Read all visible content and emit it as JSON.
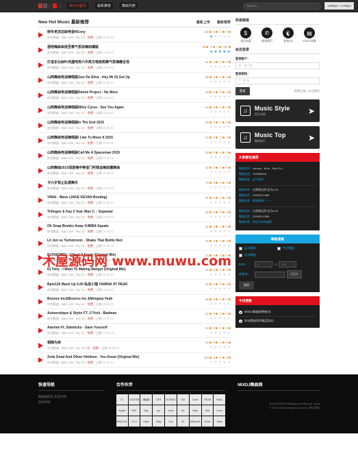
{
  "browser": {
    "nav_items": [
      {
        "label": "MIXDJ首页",
        "accent": true
      },
      {
        "label": "最新推荐",
        "accent": false
      },
      {
        "label": "舞曲列表",
        "accent": false
      }
    ],
    "search_placeholder": "Search...",
    "resolution_badge": "1366px × 1783px"
  },
  "main": {
    "title": "New Hot Music 最新推荐",
    "column_headers": [
      "最新上传",
      "最新推荐"
    ],
    "songs": [
      {
        "title": "晓冬老凉迈曲电音M1ony",
        "meta_type": "综合舞曲",
        "bpm": "Bpm 128",
        "key": "key 12",
        "tag": "免费",
        "date_label": "日期",
        "time": "15.09.02",
        "stats": [
          "128",
          "0",
          "0",
          "0"
        ],
        "stars": 1
      },
      {
        "title": "酒吧嗨曲串烧至尊气氛劲嗨劲爆版",
        "meta_type": "综合舞曲",
        "bpm": "Bpm 128",
        "key": "key 12",
        "tag": "免费",
        "date_label": "日期",
        "time": "15.09.02",
        "stats": [
          "90",
          "0",
          "0",
          "191"
        ],
        "stars": 5
      },
      {
        "title": "打造东北树叶鸿遇吧男六中英文唱夜照舞气氛嗨爆全场",
        "meta_type": "综合舞曲",
        "bpm": "Bpm 128",
        "key": "key 12",
        "tag": "免费",
        "date_label": "日期",
        "time": "15.09.02",
        "stats": [
          "82",
          "0",
          "0",
          "0"
        ],
        "stars": 0
      },
      {
        "title": "山西舞曲电话嗨唱版Geo Da Silva - Hey Mr Dj Get Up",
        "meta_type": "综合舞曲",
        "bpm": "Bpm 128",
        "key": "key 12",
        "tag": "免费",
        "date_label": "日期",
        "time": "15.09.02",
        "stats": [
          "88",
          "0",
          "0",
          "0"
        ],
        "stars": 0
      },
      {
        "title": "山西舞曲电话嗨唱版Rimini Project - No More",
        "meta_type": "综合舞曲",
        "bpm": "Bpm 128",
        "key": "key 12",
        "tag": "免费",
        "date_label": "日期",
        "time": "15.09.02",
        "stats": [
          "68",
          "0",
          "0",
          "0"
        ],
        "stars": 0
      },
      {
        "title": "山西舞曲电话嗨唱版Miley Cyrus - See You Again",
        "meta_type": "综合舞曲",
        "bpm": "Bpm 128",
        "key": "key 12",
        "tag": "免费",
        "date_label": "日期",
        "time": "15.09.02",
        "stats": [
          "84",
          "0",
          "0",
          "0"
        ],
        "stars": 0
      },
      {
        "title": "山西舞曲电话嗨唱版In The End 2015",
        "meta_type": "综合舞曲",
        "bpm": "Bpm 128",
        "key": "key 12",
        "tag": "免费",
        "date_label": "日期",
        "time": "15.09.02",
        "stats": [
          "60",
          "0",
          "0",
          "0"
        ],
        "stars": 0
      },
      {
        "title": "山西舞曲电话嗨唱版I Like To Move It 2015",
        "meta_type": "综合舞曲",
        "bpm": "Bpm 128",
        "key": "key 12",
        "tag": "免费",
        "date_label": "日期",
        "time": "15.09.02",
        "stats": [
          "54",
          "0",
          "0",
          "0"
        ],
        "stars": 0
      },
      {
        "title": "山西舞曲电话嗨唱版Call Me A Spaceman 2015",
        "meta_type": "综合舞曲",
        "bpm": "Bpm 128",
        "key": "key 12",
        "tag": "免费",
        "date_label": "日期",
        "time": "15.09.02",
        "stats": [
          "50",
          "0",
          "0",
          "0"
        ],
        "stars": 0
      },
      {
        "title": "山西舞曲2015深度嗨中等音门听贱运嗨劲爆舞曲",
        "meta_type": "综合舞曲",
        "bpm": "Bpm 128",
        "key": "key 12",
        "tag": "免费",
        "date_label": "日期",
        "time": "15.09.02",
        "stats": [
          "52",
          "0",
          "0",
          "0"
        ],
        "stars": 0
      },
      {
        "title": "卡六岁禁止乱煨舞乐",
        "meta_type": "综合舞曲",
        "bpm": "Bpm 128",
        "key": "key 12",
        "tag": "免费",
        "date_label": "日期",
        "time": "15.09.02",
        "stats": [
          "76",
          "0",
          "0",
          "0"
        ],
        "stars": 0
      },
      {
        "title": "VINAI - Wave (JAKE KEVAN Bootleg)",
        "meta_type": "综合舞曲",
        "bpm": "Bpm 128",
        "key": "key 12",
        "tag": "免费",
        "date_label": "日期",
        "time": "15.09.02",
        "stats": [
          "91",
          "0",
          "0",
          "0"
        ],
        "stars": 0
      },
      {
        "title": "Trillogee & Kay C feat. Max C. - Supastar",
        "meta_type": "综合舞曲",
        "bpm": "Bpm 128",
        "key": "key 12",
        "tag": "免费",
        "date_label": "日期",
        "time": "15.09.02",
        "stats": [
          "60",
          "0",
          "0",
          "0"
        ],
        "stars": 0
      },
      {
        "title": "Oh Snap Bombs Away G4BBA Squats",
        "meta_type": "综合舞曲",
        "bpm": "Bpm 128",
        "key": "key 12",
        "tag": "免费",
        "date_label": "日期",
        "time": "15.09.02",
        "stats": [
          "62",
          "0",
          "0",
          "0"
        ],
        "stars": 0
      },
      {
        "title": "Lil Jon vs Turbotronic - Shake That Bottle Red",
        "meta_type": "综合舞曲",
        "bpm": "Bpm 128",
        "key": "key 12",
        "tag": "免费",
        "date_label": "日期",
        "time": "15.09.02",
        "stats": [
          "63",
          "0",
          "0",
          "0"
        ],
        "stars": 0
      },
      {
        "title": "DJXIAOWEI - I Need A Freak (Original Mix)",
        "meta_type": "综合舞曲",
        "bpm": "Bpm 128",
        "key": "key 12",
        "tag": "免费",
        "date_label": "日期",
        "time": "15.09.02",
        "stats": [
          "72",
          "0",
          "0",
          "0"
        ],
        "stars": 0
      },
      {
        "title": "Dj Tony - I Want To Making Bangst (Original Mix)",
        "meta_type": "综合舞曲",
        "bpm": "Bpm 128",
        "key": "key 12",
        "tag": "免费",
        "date_label": "日期",
        "time": "15.09.02",
        "stats": [
          "57",
          "0",
          "0",
          "0"
        ],
        "stars": 0
      },
      {
        "title": "Bpm126 Mash Up 5.00 私房小猫 FAMNIA ST PEAK",
        "meta_type": "综合舞曲",
        "bpm": "Bpm 128",
        "key": "key 12",
        "tag": "免费",
        "date_label": "日期",
        "time": "15.09.02",
        "stats": [
          "65",
          "0",
          "0",
          "0"
        ],
        "stars": 0
      },
      {
        "title": "Bounce Inc&Bounce Inc &Morganj-Yeah",
        "meta_type": "综合舞曲",
        "bpm": "Bpm 128",
        "key": "key 12",
        "tag": "免费",
        "date_label": "日期",
        "time": "15.09.02",
        "stats": [
          "68",
          "0",
          "0",
          "0"
        ],
        "stars": 0
      },
      {
        "title": "Autoerotique & Styler FT. J-Trick - Badman",
        "meta_type": "综合舞曲",
        "bpm": "Bpm 128",
        "key": "key 12",
        "tag": "免费",
        "date_label": "日期",
        "time": "15.09.02",
        "stats": [
          "62",
          "0",
          "0",
          "0"
        ],
        "stars": 0
      },
      {
        "title": "Alarmm Ft. Sidekicks - Save Yourself",
        "meta_type": "综合舞曲",
        "bpm": "Bpm 128",
        "key": "key 12",
        "tag": "免费",
        "date_label": "日期",
        "time": "15.09.02",
        "stats": [
          "54",
          "0",
          "0",
          "0"
        ],
        "stars": 0
      },
      {
        "title": "相随为命",
        "meta_type": "中文舞曲",
        "bpm": "Bpm 128",
        "key": "key 孙小春",
        "tag": "免费",
        "date_label": "日期",
        "time": "15.09.18",
        "stats": [
          "64",
          "0",
          "0",
          "0"
        ],
        "stars": 0
      },
      {
        "title": "Zeds Dead And Oliver Heldens - You Know (Original Mix)",
        "meta_type": "综合舞曲",
        "bpm": "Bpm 128",
        "key": "key 12",
        "tag": "免费",
        "date_label": "日期",
        "time": "15.09.14",
        "stats": [
          "223",
          "0",
          "0",
          "0"
        ],
        "stars": 0
      }
    ]
  },
  "sidebar": {
    "quick_links": {
      "title": "快速链接",
      "items": [
        {
          "label": "会员充值",
          "icon": "dollar-icon",
          "glyph": "$"
        },
        {
          "label": "联系我们",
          "icon": "phone-icon",
          "glyph": "✆"
        },
        {
          "label": "在线QQ",
          "icon": "penguin-icon",
          "glyph": "🐧"
        },
        {
          "label": "MIXDJ详情",
          "icon": "info-icon",
          "glyph": "▤"
        }
      ]
    },
    "login": {
      "title": "会员登录",
      "user_label": "登录账户：",
      "user_placeholder": "用户名",
      "pass_label": "登录密码：",
      "pass_placeholder": "密 码",
      "submit": "登录",
      "register_link": "免费注册",
      "forgot_link": "忘记密码"
    },
    "promos": [
      {
        "title": "Music Style",
        "subtitle": "音乐风格",
        "icon": "speaker-icon"
      },
      {
        "title": "Music Top",
        "subtitle": "舞曲排行",
        "icon": "speaker-icon"
      }
    ],
    "recommend": {
      "title": "大家都在推荐",
      "key_name": "舞曲名称：",
      "key_member": "舞曲会员：",
      "key_tag": "舞曲标签：",
      "items": [
        {
          "name": "Various - Burn - Ellie Go...",
          "member": "754560505",
          "tag": "这个很好！"
        },
        {
          "name": "太原旗石网 宝马A.09",
          "member": "13453212386",
          "tag": "舞曲很棒！！～"
        },
        {
          "name": "太原旗石网 宝马A.09",
          "member": "13453212386",
          "tag": "好听又有味道哦"
        }
      ]
    },
    "search_panel": {
      "title": "舞曲速查",
      "checkboxes": [
        "英文舞曲",
        "中文舞曲",
        "总决舞曲"
      ],
      "bpm_label": "BPM：",
      "bpm_from": "0",
      "bpm_to_label": "to",
      "bpm_to": "200",
      "keyword_label": "关键词：",
      "keyword_value": "",
      "option_button": "可混交",
      "submit": "搜索"
    },
    "updates": {
      "title": "今日更新",
      "items": [
        "MIXDJ舞曲网更新(0)",
        "本站舞曲同步精品包(0)"
      ]
    }
  },
  "footer": {
    "nav": {
      "title": "快速导航",
      "links": [
        "舞曲网简结",
        "恋波声明",
        "免责申明"
      ]
    },
    "partners": {
      "title": "合作伙伴",
      "logos": [
        "DJ",
        "DJCATDB",
        "舞曲网",
        "DTM",
        "ULTRADC",
        "DJ8",
        "Curve",
        "YBLAB",
        "MusiC",
        "PopMix",
        "RMC",
        "Disc",
        "Axe",
        "1Hero",
        "JKL",
        "Hawk",
        "Wolf",
        "Crown",
        "BRACOOL",
        "S.E.X",
        "Paper",
        "Wing",
        "Lion",
        "S2",
        "DjRecords",
        "Green",
        "Zebra"
      ]
    },
    "about": {
      "title": "MIXDJ舞曲网",
      "line1": "Email:5942100785@qq.com/Support: mixdj",
      "line2": "© 2018-2019 www.djyma.com Inc. 图六游标"
    }
  },
  "watermark": "木屋源码网 www.muwu.com"
}
